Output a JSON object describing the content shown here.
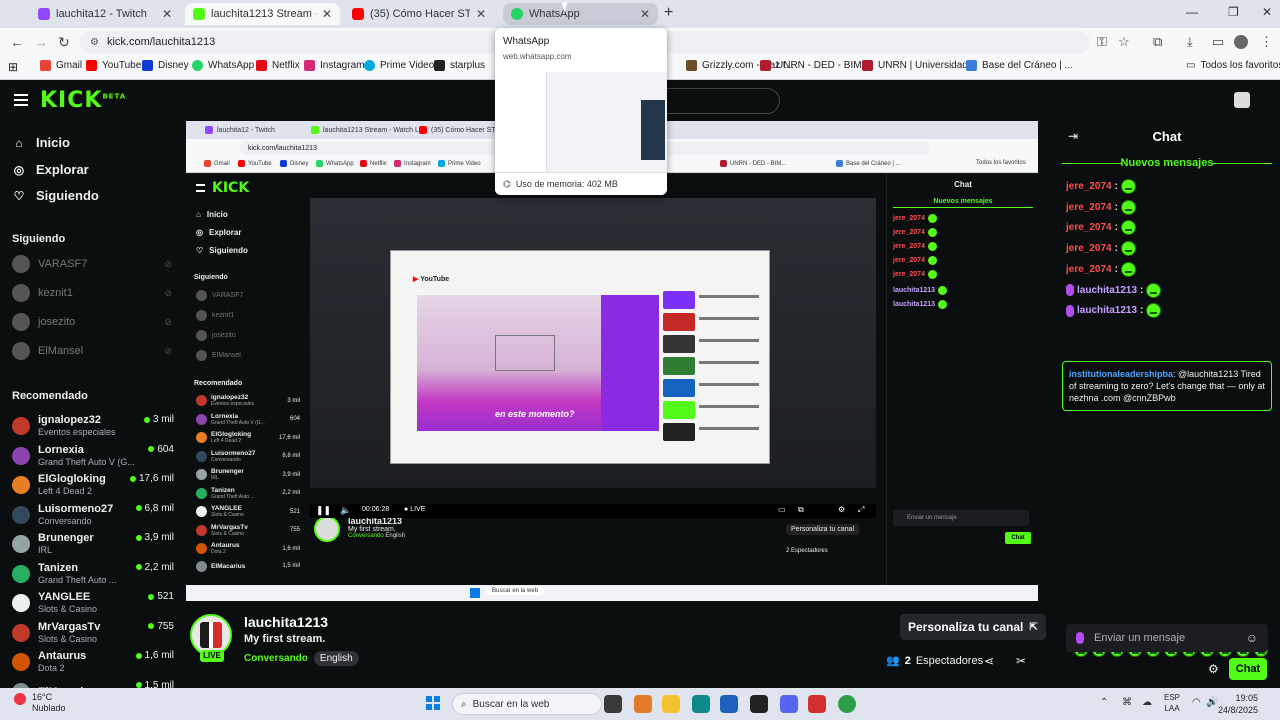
{
  "browser": {
    "tabs": [
      {
        "title": "lauchita12 - Twitch",
        "color": "#9146ff"
      },
      {
        "title": "lauchita1213 Stream - Watch L",
        "color": "#53fc18"
      },
      {
        "title": "(35) Cómo Hacer STREAMS",
        "color": "#ff0000"
      },
      {
        "title": "WhatsApp",
        "color": "#25d366"
      }
    ],
    "url": "kick.com/lauchita1213",
    "bookmarks": [
      {
        "label": "Gmail",
        "color": "#ea4335"
      },
      {
        "label": "YouTube",
        "color": "#ff0000"
      },
      {
        "label": "Disney",
        "color": "#113ccf"
      },
      {
        "label": "WhatsApp",
        "color": "#25d366"
      },
      {
        "label": "Netflix",
        "color": "#e50914"
      },
      {
        "label": "Instagram",
        "color": "#d62976"
      },
      {
        "label": "Prime Video",
        "color": "#00a8e1"
      },
      {
        "label": "starplus",
        "color": "#222222"
      },
      {
        "label": "Grizzly.com - Haz t...",
        "color": "#6b4f2a"
      },
      {
        "label": "UNRN - DED - BIM...",
        "color": "#b01c2e"
      },
      {
        "label": "UNRN | Universidad...",
        "color": "#b01c2e"
      },
      {
        "label": "Base del Cráneo | ...",
        "color": "#3b7dd8"
      }
    ],
    "all_bookmarks": "Todos los favoritos"
  },
  "preview": {
    "title": "WhatsApp",
    "url": "web.whatsapp.com",
    "memory": "Uso de memoria: 402 MB"
  },
  "kick": {
    "logo": "KICK",
    "logo_beta": "BETA",
    "nav": [
      {
        "label": "Inicio",
        "icon": "⌂"
      },
      {
        "label": "Explorar",
        "icon": "◎"
      },
      {
        "label": "Siguiendo",
        "icon": "♡"
      }
    ],
    "following_header": "Siguiendo",
    "following": [
      "VARASF7",
      "keznit1",
      "josezito",
      "ElMansel"
    ],
    "recommended_header": "Recomendado",
    "recommended": [
      {
        "name": "ignalopez32",
        "category": "Eventos especiales",
        "viewers": "3 mil",
        "color": "#c0392b"
      },
      {
        "name": "Lornexia",
        "category": "Grand Theft Auto V (G...",
        "viewers": "604",
        "color": "#8e44ad"
      },
      {
        "name": "ElGlogloking",
        "category": "Left 4 Dead 2",
        "viewers": "17,6 mil",
        "color": "#e67e22"
      },
      {
        "name": "Luisormeno27",
        "category": "Conversando",
        "viewers": "6,8 mil",
        "color": "#34495e"
      },
      {
        "name": "Brunenger",
        "category": "IRL",
        "viewers": "3,9 mil",
        "color": "#95a5a6"
      },
      {
        "name": "Tanizen",
        "category": "Grand Theft Auto ...",
        "viewers": "2,2 mil",
        "color": "#27ae60"
      },
      {
        "name": "YANGLEE",
        "category": "Slots & Casino",
        "viewers": "521",
        "color": "#ecf0f1"
      },
      {
        "name": "MrVargasTv",
        "category": "Slots & Casino",
        "viewers": "755",
        "color": "#c0392b"
      },
      {
        "name": "Antaurus",
        "category": "Dota 2",
        "viewers": "1,6 mil",
        "color": "#d35400"
      },
      {
        "name": "ElMacarius",
        "category": "",
        "viewers": "1,5 mil",
        "color": "#7f8c8d"
      }
    ],
    "streamer": {
      "name": "lauchita1213",
      "title": "My first stream.",
      "category": "Conversando",
      "language": "English",
      "live": "LIVE"
    },
    "customize": "Personaliza tu canal",
    "viewers_count": "2",
    "viewers_label": "Espectadores"
  },
  "chat": {
    "title": "Chat",
    "new_messages": "Nuevos mensajes",
    "messages": [
      {
        "user": "jere_2074",
        "mod": false
      },
      {
        "user": "jere_2074",
        "mod": false
      },
      {
        "user": "jere_2074",
        "mod": false
      },
      {
        "user": "jere_2074",
        "mod": false
      },
      {
        "user": "jere_2074",
        "mod": false
      },
      {
        "user": "lauchita1213",
        "mod": true
      },
      {
        "user": "lauchita1213",
        "mod": true
      }
    ],
    "highlight": {
      "user": "institutionaleadershipba",
      "text": "@lauchita1213 Tired of streaming to zero? Let's change that — only at nezhna .com @cnnZBPwb"
    },
    "input_placeholder": "Enviar un mensaje",
    "send": "Chat"
  },
  "nested": {
    "time": "00:06:28",
    "live": "LIVE",
    "caption": "en este momento?",
    "search_placeholder": "Buscar"
  },
  "taskbar": {
    "temp": "16°C",
    "weather": "Nublado",
    "search": "Buscar en la web",
    "lang1": "ESP",
    "lang2": "LAA",
    "time": "19:05",
    "date": "24/8/2025"
  }
}
